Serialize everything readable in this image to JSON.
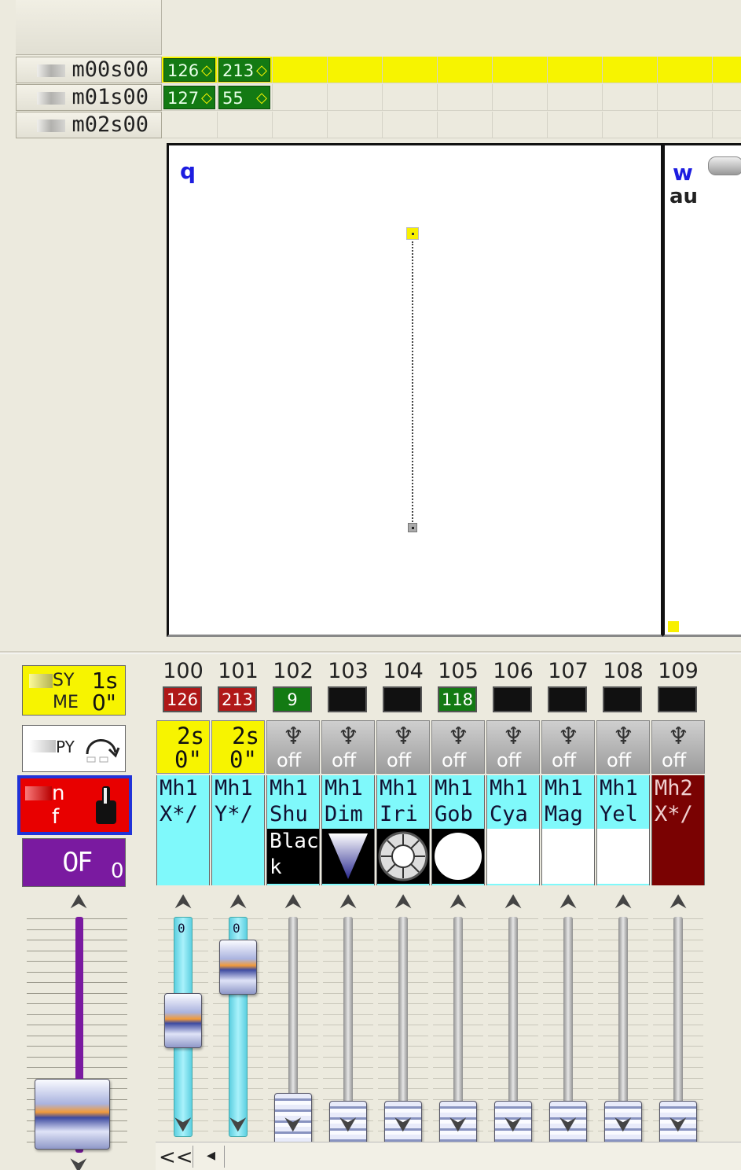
{
  "timeline": {
    "rows": [
      {
        "label": "m00s00",
        "values": [
          "126",
          "213"
        ],
        "highlighted": true
      },
      {
        "label": "m01s00",
        "values": [
          "127",
          "55"
        ],
        "highlighted": false
      },
      {
        "label": "m02s00",
        "values": [],
        "highlighted": false
      }
    ],
    "highlight_color": "#f7f400"
  },
  "panes": {
    "left_label": "q",
    "right_label": "w",
    "right_text": "au"
  },
  "controls": {
    "fade": {
      "line1_prefix": "SY",
      "line1_value": "1s",
      "line2_prefix": "ME",
      "line2_value": "0\""
    },
    "copy": {
      "label": "PY"
    },
    "onoff": {
      "line1": "n",
      "line2": "f"
    },
    "master": {
      "label_left": "0F",
      "label_right": "0"
    }
  },
  "channels": [
    {
      "number": "100",
      "value": "126",
      "value_color": "#b01818",
      "mode_top": "2s",
      "mode_bottom": "0\"",
      "mode_type": "time",
      "name1": "Mh1",
      "name2": "X*∕",
      "sub": "",
      "name_bg": "#7ff9fb",
      "fader": 0.55
    },
    {
      "number": "101",
      "value": "213",
      "value_color": "#b01818",
      "mode_top": "2s",
      "mode_bottom": "0\"",
      "mode_type": "time",
      "name1": "Mh1",
      "name2": "Y*∕",
      "sub": "",
      "name_bg": "#7ff9fb",
      "fader": 0.82
    },
    {
      "number": "102",
      "value": "9",
      "value_color": "#137a13",
      "mode_top": "",
      "mode_bottom": "off",
      "mode_type": "snap",
      "name1": "Mh1",
      "name2": "Shu",
      "sub": "Black",
      "sub_type": "text",
      "name_bg": "#7ff9fb",
      "fader": 0.04
    },
    {
      "number": "103",
      "value": "",
      "value_color": "#111111",
      "mode_top": "",
      "mode_bottom": "off",
      "mode_type": "snap",
      "name1": "Mh1",
      "name2": "Dim",
      "sub": "",
      "sub_type": "dimmer",
      "name_bg": "#7ff9fb",
      "fader": 0.0
    },
    {
      "number": "104",
      "value": "",
      "value_color": "#111111",
      "mode_top": "",
      "mode_bottom": "off",
      "mode_type": "snap",
      "name1": "Mh1",
      "name2": "Iri",
      "sub": "",
      "sub_type": "iris",
      "name_bg": "#7ff9fb",
      "fader": 0.0
    },
    {
      "number": "105",
      "value": "118",
      "value_color": "#137a13",
      "mode_top": "",
      "mode_bottom": "off",
      "mode_type": "snap",
      "name1": "Mh1",
      "name2": "Gob",
      "sub": "",
      "sub_type": "gobo",
      "name_bg": "#7ff9fb",
      "fader": 0.0
    },
    {
      "number": "106",
      "value": "",
      "value_color": "#111111",
      "mode_top": "",
      "mode_bottom": "off",
      "mode_type": "snap",
      "name1": "Mh1",
      "name2": "Cya",
      "sub": "",
      "sub_type": "blank",
      "name_bg": "#7ff9fb",
      "fader": 0.0
    },
    {
      "number": "107",
      "value": "",
      "value_color": "#111111",
      "mode_top": "",
      "mode_bottom": "off",
      "mode_type": "snap",
      "name1": "Mh1",
      "name2": "Mag",
      "sub": "",
      "sub_type": "blank",
      "name_bg": "#7ff9fb",
      "fader": 0.0
    },
    {
      "number": "108",
      "value": "",
      "value_color": "#111111",
      "mode_top": "",
      "mode_bottom": "off",
      "mode_type": "snap",
      "name1": "Mh1",
      "name2": "Yel",
      "sub": "",
      "sub_type": "blank",
      "name_bg": "#7ff9fb",
      "fader": 0.0
    },
    {
      "number": "109",
      "value": "",
      "value_color": "#111111",
      "mode_top": "",
      "mode_bottom": "off",
      "mode_type": "snap",
      "name1": "Mh2",
      "name2": "X*∕",
      "sub": "",
      "sub_type": "dark",
      "name_bg": "#7a0202",
      "fader": 0.0
    }
  ],
  "icons": {
    "up": "fader-up-arrow-icon",
    "down": "fader-down-arrow-icon",
    "snap": "snap-handle-icon"
  },
  "scrollbar": {
    "first_label": "<<",
    "prev_label": "◂"
  }
}
